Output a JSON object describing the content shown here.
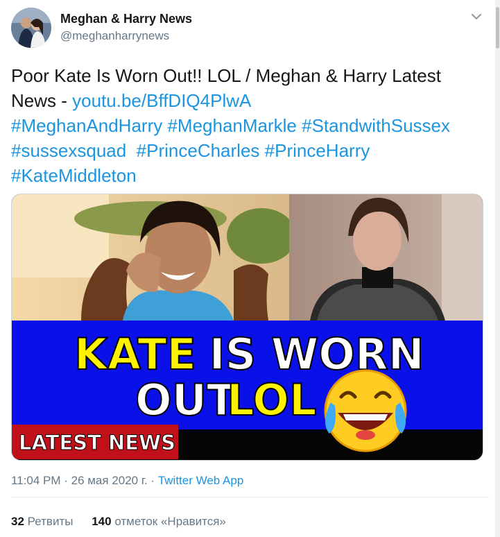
{
  "author": {
    "name": "Meghan & Harry News",
    "handle": "@meghanharrynews"
  },
  "tweet": {
    "text_line1": "Poor Kate Is Worn Out!! LOL / Meghan & Harry Latest",
    "text_line2_prefix": "News - ",
    "link": "youtu.be/BffDIQ4PlwA",
    "hashtags_line3": "#MeghanAndHarry #MeghanMarkle #StandwithSussex",
    "hashtags_line4": "#sussexsquad  #PrinceCharles #PrinceHarry",
    "hashtags_line5": "#KateMiddleton"
  },
  "media": {
    "headline_word1": "KATE",
    "headline_rest1": " IS WORN",
    "headline_word2": "OUT ",
    "headline_lol": "LOL",
    "badge": "LATEST NEWS",
    "colors": {
      "banner_blue": "#0a10e8",
      "headline_yellow": "#fff200",
      "badge_red": "#c0111a"
    }
  },
  "meta": {
    "time": "11:04 PM · 26 мая 2020 г. · ",
    "source": "Twitter Web App"
  },
  "stats": {
    "retweets_count": "32",
    "retweets_label": "Ретвиты",
    "likes_count": "140",
    "likes_label": "отметок «Нравится»"
  },
  "icons": [
    "avatar-image",
    "chevron-down-icon",
    "laughing-emoji-icon"
  ]
}
